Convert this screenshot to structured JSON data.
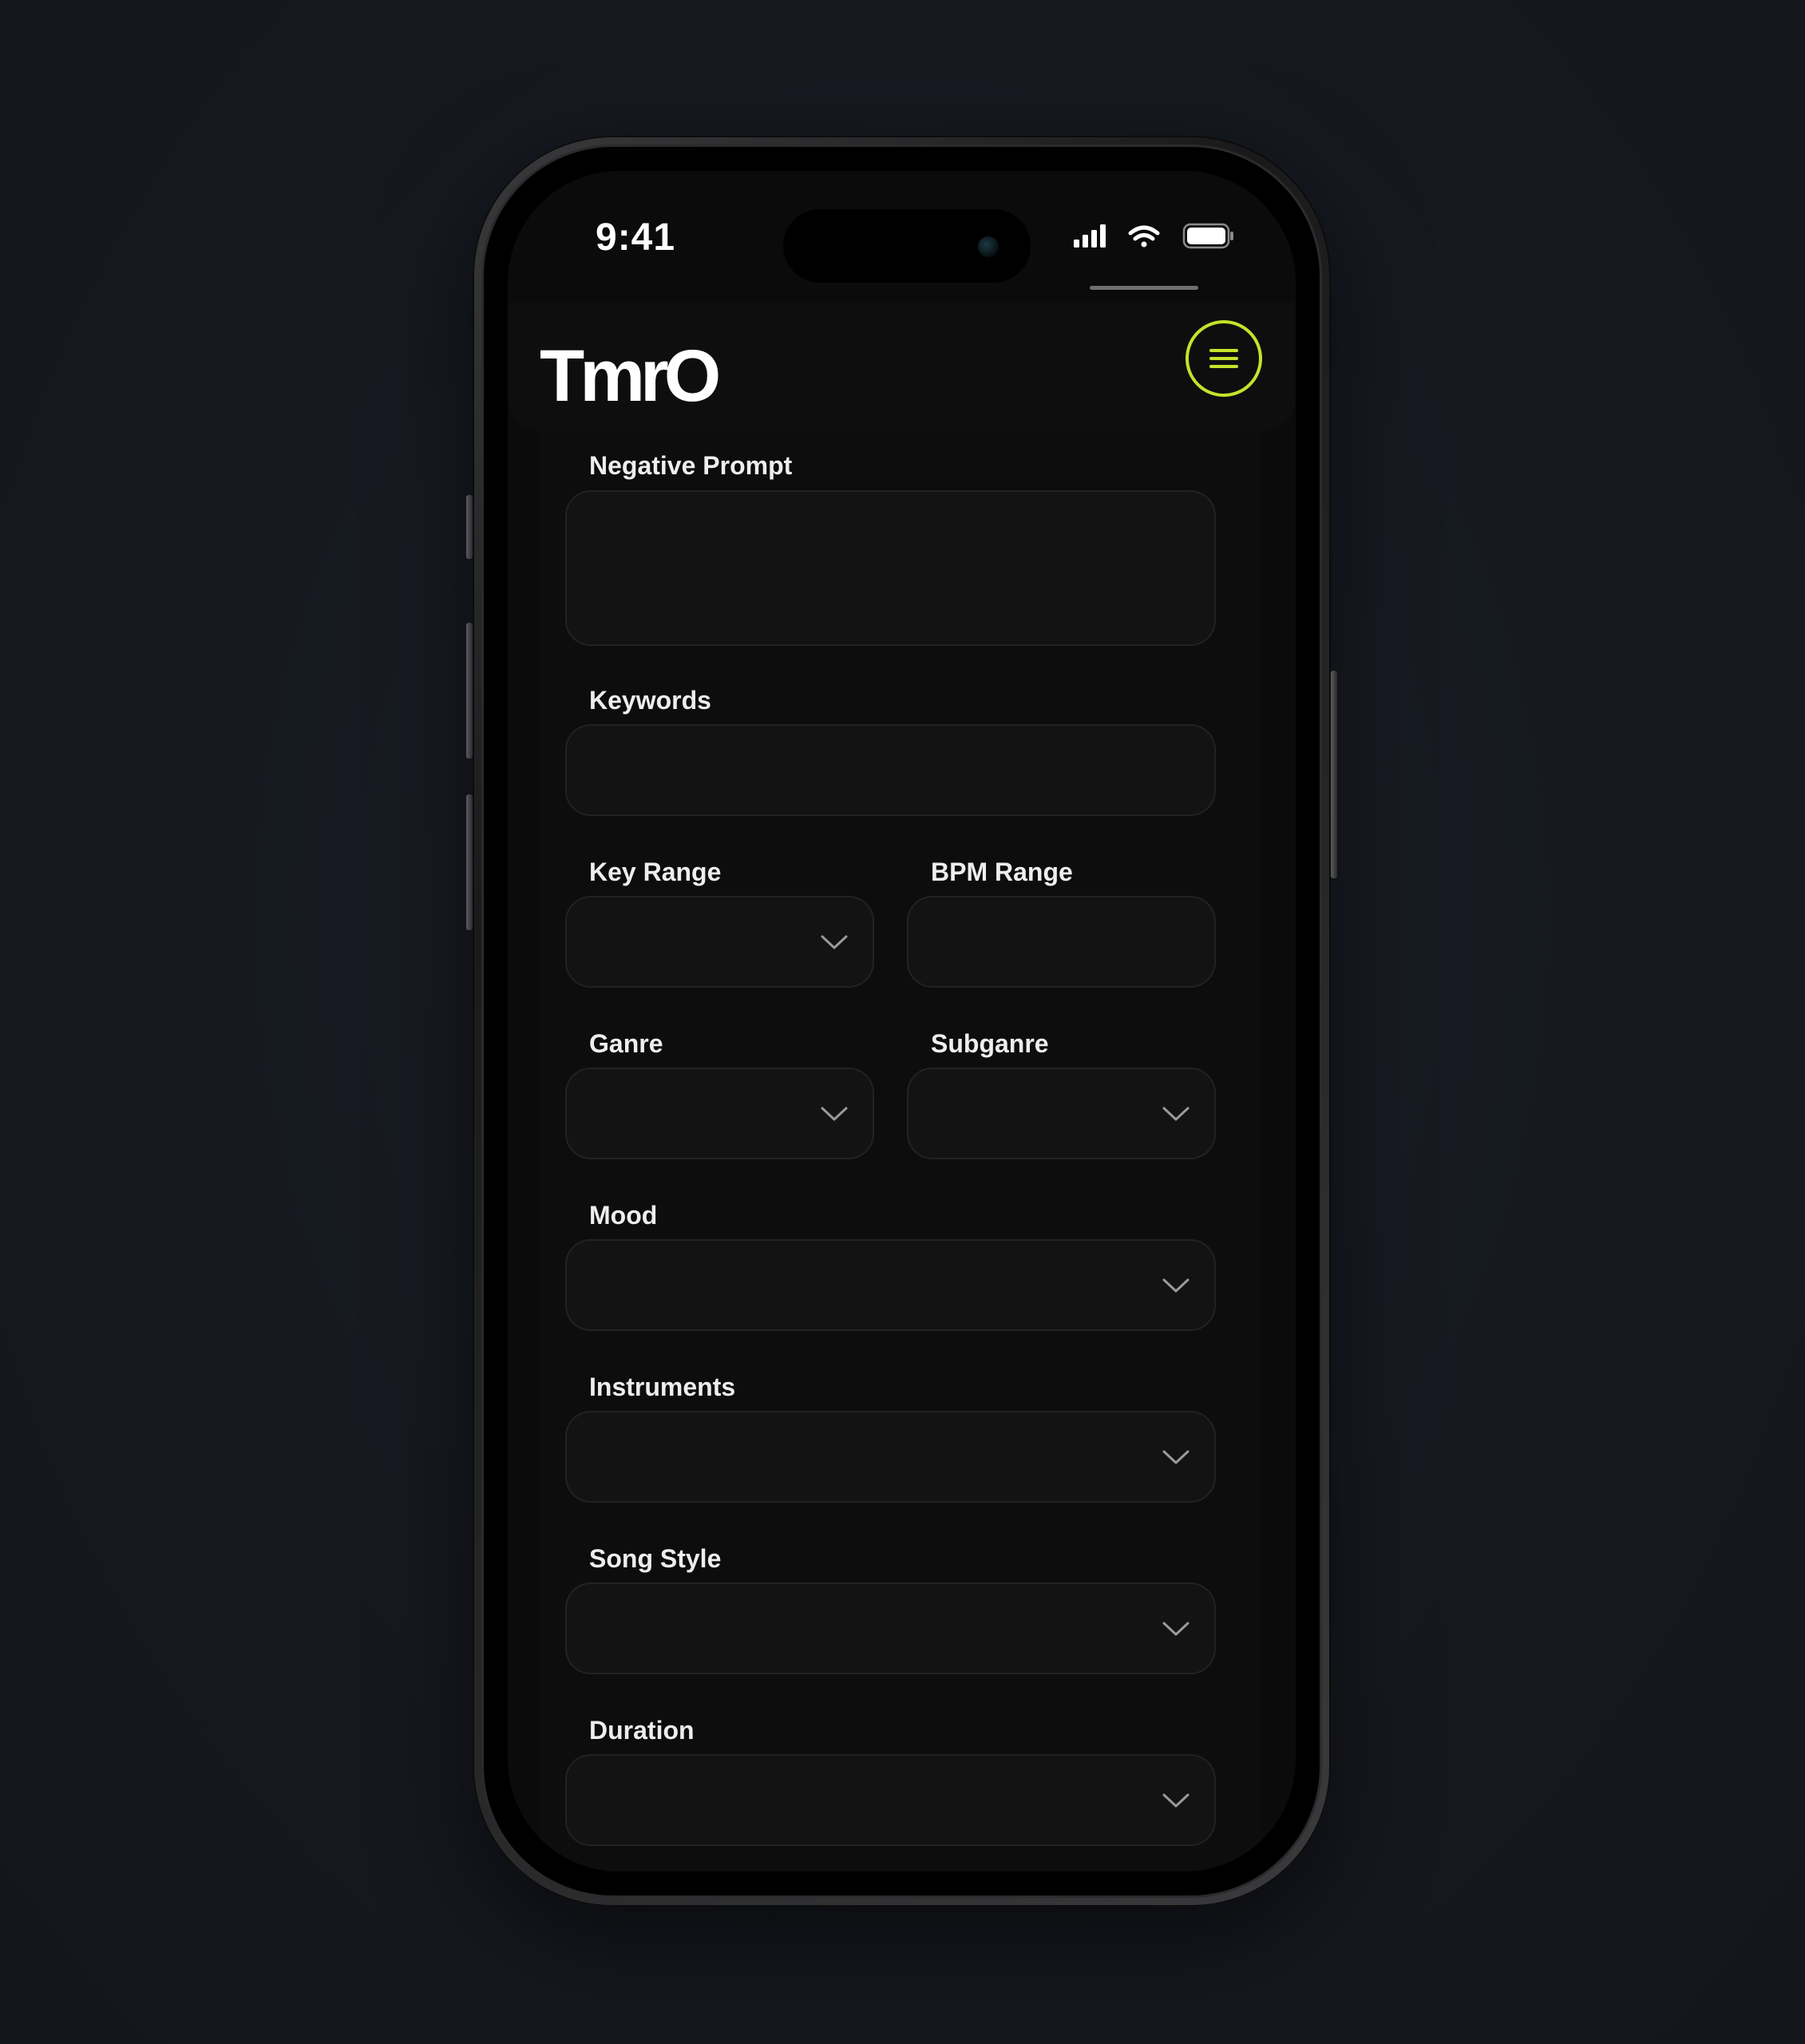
{
  "status_bar": {
    "time": "9:41"
  },
  "app": {
    "logo": "TmrO",
    "accent_color": "#c6e22a",
    "menu_icon": "hamburger-menu-icon"
  },
  "form": {
    "negative_prompt": {
      "label": "Negative Prompt",
      "value": ""
    },
    "keywords": {
      "label": "Keywords",
      "value": ""
    },
    "key_range": {
      "label": "Key Range",
      "value": ""
    },
    "bpm_range": {
      "label": "BPM Range",
      "value": ""
    },
    "genre": {
      "label": "Ganre",
      "value": ""
    },
    "subgenre": {
      "label": "Subganre",
      "value": ""
    },
    "mood": {
      "label": "Mood",
      "value": ""
    },
    "instruments": {
      "label": "Instruments",
      "value": ""
    },
    "song_style": {
      "label": "Song Style",
      "value": ""
    },
    "duration": {
      "label": "Duration",
      "value": ""
    }
  }
}
